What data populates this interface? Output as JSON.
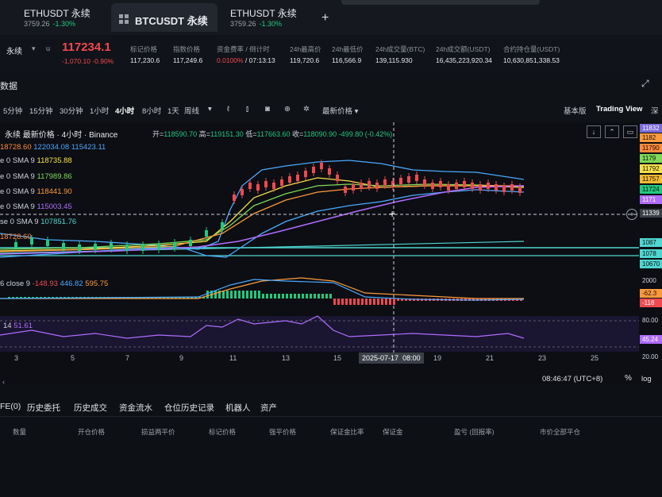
{
  "tabs": [
    {
      "symbol": "ETHUSDT 永续",
      "price": "3759.26",
      "change": "-1.30%"
    },
    {
      "symbol": "BTCUSDT 永续",
      "active": true
    },
    {
      "symbol": "ETHUSDT 永续",
      "price": "3759.26",
      "change": "-1.30%"
    }
  ],
  "tab_add": "+",
  "header": {
    "symbol_suffix": "永续",
    "last_price": "117234.1",
    "price_change": "-1,070.10",
    "price_change_pct": "-0.90%",
    "stats": [
      {
        "label": "标记价格",
        "value": "117,230.6"
      },
      {
        "label": "指数价格",
        "value": "117,249.6"
      },
      {
        "label": "资金费率 / 倒计时",
        "value_rate": "0.0100%",
        "value_time": " / 07:13:13"
      },
      {
        "label": "24h最高价",
        "value": "119,720.6"
      },
      {
        "label": "24h最低价",
        "value": "116,566.9"
      },
      {
        "label": "24h成交量(BTC)",
        "value": "139,115.930"
      },
      {
        "label": "24h成交额(USDT)",
        "value": "16,435,223,920.34"
      },
      {
        "label": "合约持仓量(USDT)",
        "value": "10,630,851,338.53"
      }
    ]
  },
  "section_title": "数据",
  "toolbar": {
    "intervals": [
      "5分钟",
      "15分钟",
      "30分钟",
      "1小时",
      "4小时",
      "8小时",
      "1天",
      "周线"
    ],
    "active_interval": "4小时",
    "price_type": "最新价格",
    "view_basic": "基本版",
    "view_tv": "Trading View",
    "view_depth": "深"
  },
  "chart": {
    "legend_title": "永续 最新价格 · 4小时 · Binance",
    "ohlc": {
      "open_label": "开=",
      "open": "118590.70",
      "high_label": "高=",
      "high": "119151.30",
      "low_label": "低=",
      "low": "117663.60",
      "close_label": "收=",
      "close": "118090.90",
      "change": "-499.80",
      "change_pct": "(-0.42%)"
    },
    "boll_values": [
      "18728.60",
      "122034.08",
      "115423.11"
    ],
    "sma_lines": [
      {
        "label": "e 0 SMA 9",
        "value": "118735.88",
        "color": "#f6e04a"
      },
      {
        "label": "e 0 SMA 9",
        "value": "117989.86",
        "color": "#7ed957"
      },
      {
        "label": "e 0 SMA 9",
        "value": "118441.90",
        "color": "#ff9a3c"
      },
      {
        "label": "e 0 SMA 9",
        "value": "115003.45",
        "color": "#b06cff"
      },
      {
        "label": "se 0 SMA 9",
        "value": "107851.76",
        "color": "#4fd6d0"
      }
    ],
    "boll2_value": "18728.60",
    "macd_label": "6 close 9",
    "macd_values": [
      "-148.93",
      "446.82",
      "595.75"
    ],
    "rsi_label": "14",
    "rsi_value": "51.61",
    "x_ticks": [
      "3",
      "5",
      "7",
      "9",
      "11",
      "13",
      "15",
      "19",
      "21",
      "23",
      "25"
    ],
    "crosshair_date": "2025-07-17",
    "crosshair_time": "08:00",
    "right_prices": [
      "11832",
      "1182",
      "11790",
      "1179",
      "11792",
      "11757",
      "11724",
      "1171",
      "11339",
      "1087",
      "1078",
      "10670"
    ],
    "macd_axis": [
      "2000",
      "-62.3",
      "-118"
    ],
    "rsi_axis": [
      "80.00",
      "45.24",
      "20.00"
    ],
    "clock": "08:46:47 (UTC+8)",
    "pct_btn": "%",
    "log_btn": "log"
  },
  "chart_data": {
    "type": "line",
    "series_ma": [
      {
        "name": "SMA",
        "values": [
          113800,
          114100,
          114600,
          115500,
          117600,
          118900,
          119500,
          118700,
          118500,
          118600,
          118400,
          118300
        ]
      }
    ]
  },
  "bottom": {
    "tabs": [
      "FE(0)",
      "历史委托",
      "历史成交",
      "资金流水",
      "仓位历史记录",
      "机器人",
      "资产"
    ],
    "columns": [
      "数量",
      "开仓价格",
      "损益两平价",
      "标记价格",
      "强平价格",
      "保证金比率",
      "保证金",
      "盈亏 (回报率)",
      "市价全部平仓"
    ]
  },
  "colors": {
    "up": "#21c97f",
    "down": "#f0494f",
    "accent": "#f3ba2f"
  }
}
